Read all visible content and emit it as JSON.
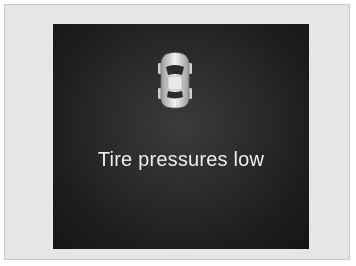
{
  "alert": {
    "icon": "car-top-view-icon",
    "message": "Tire pressures low"
  }
}
